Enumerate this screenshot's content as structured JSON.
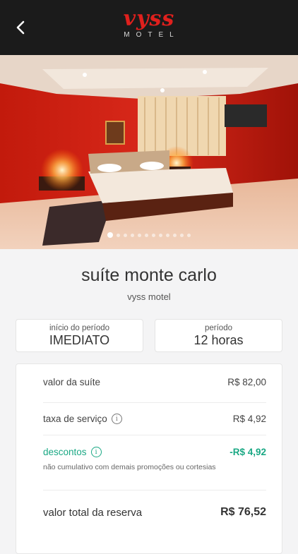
{
  "header": {
    "logo_script": "vyss",
    "logo_sub": "MOTEL",
    "back_icon": "chevron-left-icon"
  },
  "gallery": {
    "total_images": 12,
    "active_index": 0
  },
  "suite": {
    "name": "suíte monte carlo",
    "motel": "vyss motel"
  },
  "period": {
    "start_label": "início do período",
    "start_value": "IMEDIATO",
    "duration_label": "período",
    "duration_value": "12 horas"
  },
  "summary": {
    "suite_label": "valor da suíte",
    "suite_value": "R$ 82,00",
    "fee_label": "taxa de serviço",
    "fee_value": "R$ 4,92",
    "discount_label": "descontos",
    "discount_value": "-R$ 4,92",
    "discount_note": "não cumulativo com demais promoções ou cortesias",
    "total_label": "valor total da reserva",
    "total_value": "R$ 76,52"
  },
  "colors": {
    "accent": "#1aa884",
    "brand": "#e0201d",
    "header_bg": "#1b1b1b"
  }
}
